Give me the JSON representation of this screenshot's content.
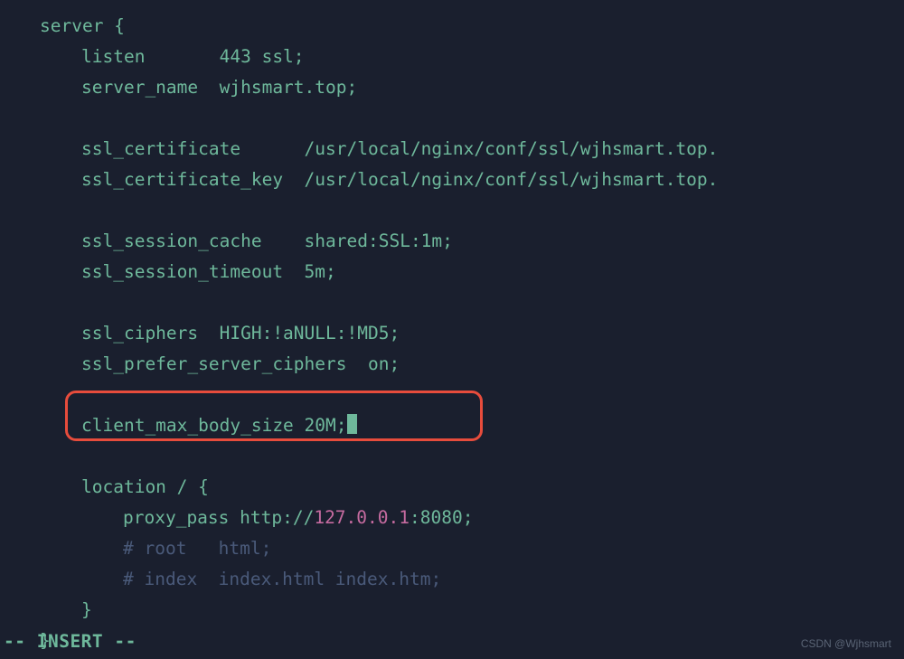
{
  "config": {
    "lines": [
      {
        "indent": 0,
        "segments": [
          {
            "text": "server {",
            "cls": "keyword"
          }
        ]
      },
      {
        "indent": 1,
        "segments": [
          {
            "text": "listen       443 ssl;",
            "cls": "keyword"
          }
        ]
      },
      {
        "indent": 1,
        "segments": [
          {
            "text": "server_name  wjhsmart.top;",
            "cls": "keyword"
          }
        ]
      },
      {
        "indent": 0,
        "segments": []
      },
      {
        "indent": 1,
        "segments": [
          {
            "text": "ssl_certificate      /usr/local/nginx/conf/ssl/wjhsmart.top.",
            "cls": "keyword"
          }
        ]
      },
      {
        "indent": 1,
        "segments": [
          {
            "text": "ssl_certificate_key  /usr/local/nginx/conf/ssl/wjhsmart.top.",
            "cls": "keyword"
          }
        ]
      },
      {
        "indent": 0,
        "segments": []
      },
      {
        "indent": 1,
        "segments": [
          {
            "text": "ssl_session_cache    shared:SSL:1m;",
            "cls": "keyword"
          }
        ]
      },
      {
        "indent": 1,
        "segments": [
          {
            "text": "ssl_session_timeout  5m;",
            "cls": "keyword"
          }
        ]
      },
      {
        "indent": 0,
        "segments": []
      },
      {
        "indent": 1,
        "segments": [
          {
            "text": "ssl_ciphers  HIGH:!aNULL:!MD5;",
            "cls": "keyword"
          }
        ]
      },
      {
        "indent": 1,
        "segments": [
          {
            "text": "ssl_prefer_server_ciphers  on;",
            "cls": "keyword"
          }
        ]
      },
      {
        "indent": 0,
        "segments": []
      },
      {
        "indent": 1,
        "segments": [
          {
            "text": "client_max_body_size 20M;",
            "cls": "keyword"
          }
        ],
        "cursor": true
      },
      {
        "indent": 0,
        "segments": []
      },
      {
        "indent": 1,
        "segments": [
          {
            "text": "location / {",
            "cls": "keyword"
          }
        ]
      },
      {
        "indent": 2,
        "segments": [
          {
            "text": "proxy_pass http://",
            "cls": "keyword"
          },
          {
            "text": "127.0.0.1",
            "cls": "ip"
          },
          {
            "text": ":8080;",
            "cls": "keyword"
          }
        ]
      },
      {
        "indent": 2,
        "segments": [
          {
            "text": "# root   html;",
            "cls": "comment"
          }
        ]
      },
      {
        "indent": 2,
        "segments": [
          {
            "text": "# index  index.html index.htm;",
            "cls": "comment"
          }
        ]
      },
      {
        "indent": 1,
        "segments": [
          {
            "text": "}",
            "cls": "keyword"
          }
        ]
      },
      {
        "indent": 0,
        "segments": [
          {
            "text": "}",
            "cls": "keyword"
          }
        ]
      }
    ]
  },
  "status": {
    "mode": "-- INSERT --"
  },
  "watermark": {
    "text": "CSDN @Wjhsmart"
  }
}
